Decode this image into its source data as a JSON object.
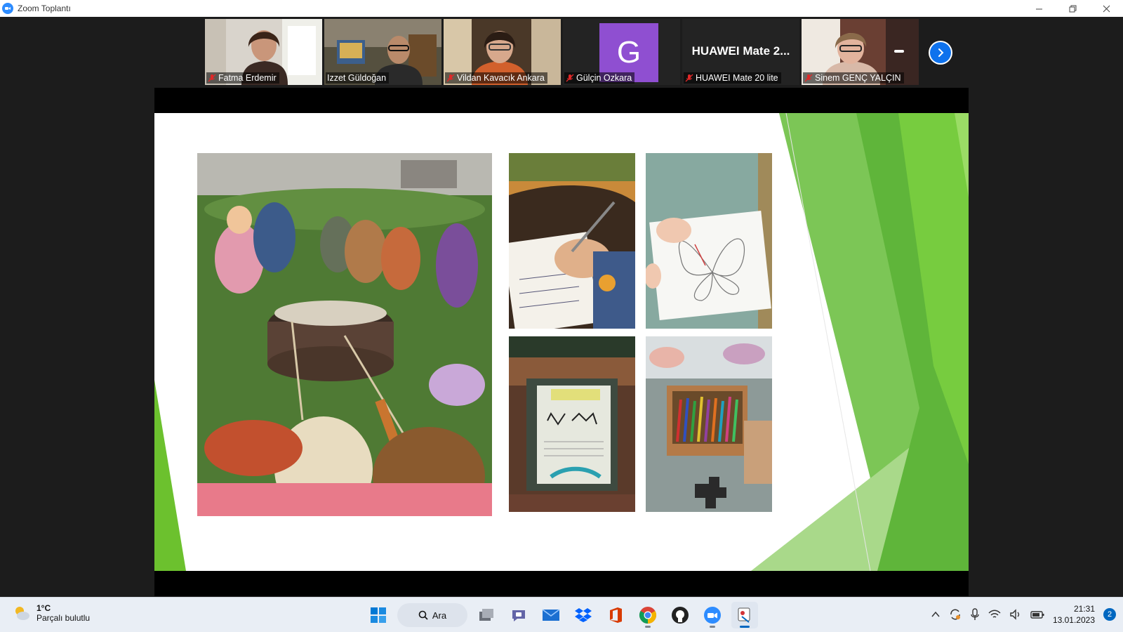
{
  "window": {
    "title": "Zoom Toplantı"
  },
  "participants": [
    {
      "name": "Fatma Erdemir",
      "muted": true
    },
    {
      "name": "Izzet Güldoğan",
      "muted": false,
      "active": true
    },
    {
      "name": "Vildan Kavacık Ankara",
      "muted": true
    },
    {
      "name": "Gülçin Ozkara",
      "muted": true,
      "avatar_letter": "G",
      "avatar_color": "#8f4fd1"
    },
    {
      "name": "HUAWEI Mate 20 lite",
      "muted": true,
      "display_title": "HUAWEI  Mate 2..."
    },
    {
      "name": "Sinem GENÇ YALÇIN",
      "muted": true
    }
  ],
  "gallery_next_icon": "chevron-right-icon",
  "colors": {
    "zoom_blue": "#0e72ed",
    "slide_green": "#6cc12e",
    "mic_muted": "#e02828"
  },
  "taskbar": {
    "weather": {
      "temp": "1°C",
      "desc": "Parçalı bulutlu"
    },
    "search_label": "Ara",
    "clock": {
      "time": "21:31",
      "date": "13.01.2023"
    },
    "notifications": "2",
    "apps": [
      "start-icon",
      "search",
      "task-view-icon",
      "teams-chat-icon",
      "mail-icon",
      "dropbox-icon",
      "office-icon",
      "chrome-icon",
      "github-icon",
      "zoom-icon",
      "snipping-tool-icon"
    ]
  }
}
